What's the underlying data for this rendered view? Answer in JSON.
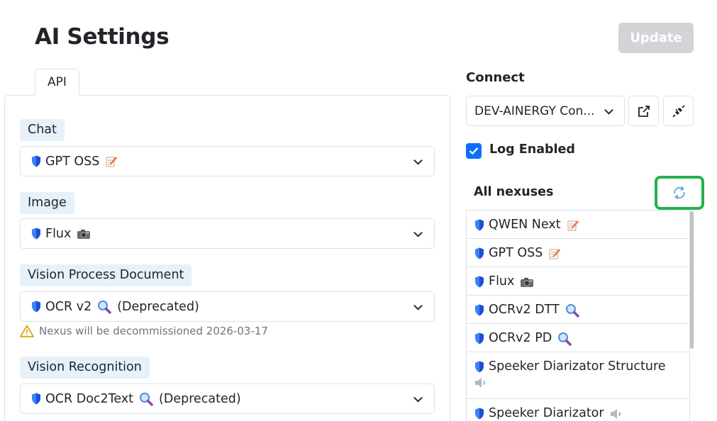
{
  "page": {
    "title": "AI Settings",
    "update_label": "Update"
  },
  "tabs": [
    {
      "label": "API",
      "active": true
    }
  ],
  "fields": [
    {
      "label": "Chat",
      "value": "GPT OSS",
      "icon": "memo-emoji"
    },
    {
      "label": "Image",
      "value": "Flux",
      "icon": "camera-emoji"
    },
    {
      "label": "Vision Process Document",
      "value": "OCR v2",
      "icon": "magnifier-emoji",
      "suffix": "(Deprecated)",
      "warning": "Nexus will be decommissioned 2026-03-17"
    },
    {
      "label": "Vision Recognition",
      "value": "OCR Doc2Text",
      "icon": "magnifier-emoji",
      "suffix": "(Deprecated)"
    }
  ],
  "connect": {
    "label": "Connect",
    "selected": "DEV-AINERGY Con...",
    "open_icon": "external-link-icon",
    "disconnect_icon": "unplug-icon"
  },
  "log": {
    "label": "Log Enabled",
    "checked": true
  },
  "nexuses": {
    "title": "All nexuses",
    "refresh_icon": "refresh-icon",
    "items": [
      {
        "name": "QWEN Next",
        "icon": "memo-emoji"
      },
      {
        "name": "GPT OSS",
        "icon": "memo-emoji"
      },
      {
        "name": "Flux",
        "icon": "camera-emoji"
      },
      {
        "name": "OCRv2 DTT",
        "icon": "magnifier-emoji"
      },
      {
        "name": "OCRv2 PD",
        "icon": "magnifier-emoji"
      },
      {
        "name": "Speeker Diarizator Structure",
        "icon": "speaker-emoji"
      },
      {
        "name": "Speeker Diarizator",
        "icon": "speaker-emoji"
      }
    ]
  },
  "colors": {
    "primary": "#0d6efd",
    "label_bg": "#e7f1fa",
    "disabled_button": "#d2d4d7",
    "highlight": "#22b14c",
    "warning": "#e0a800"
  }
}
